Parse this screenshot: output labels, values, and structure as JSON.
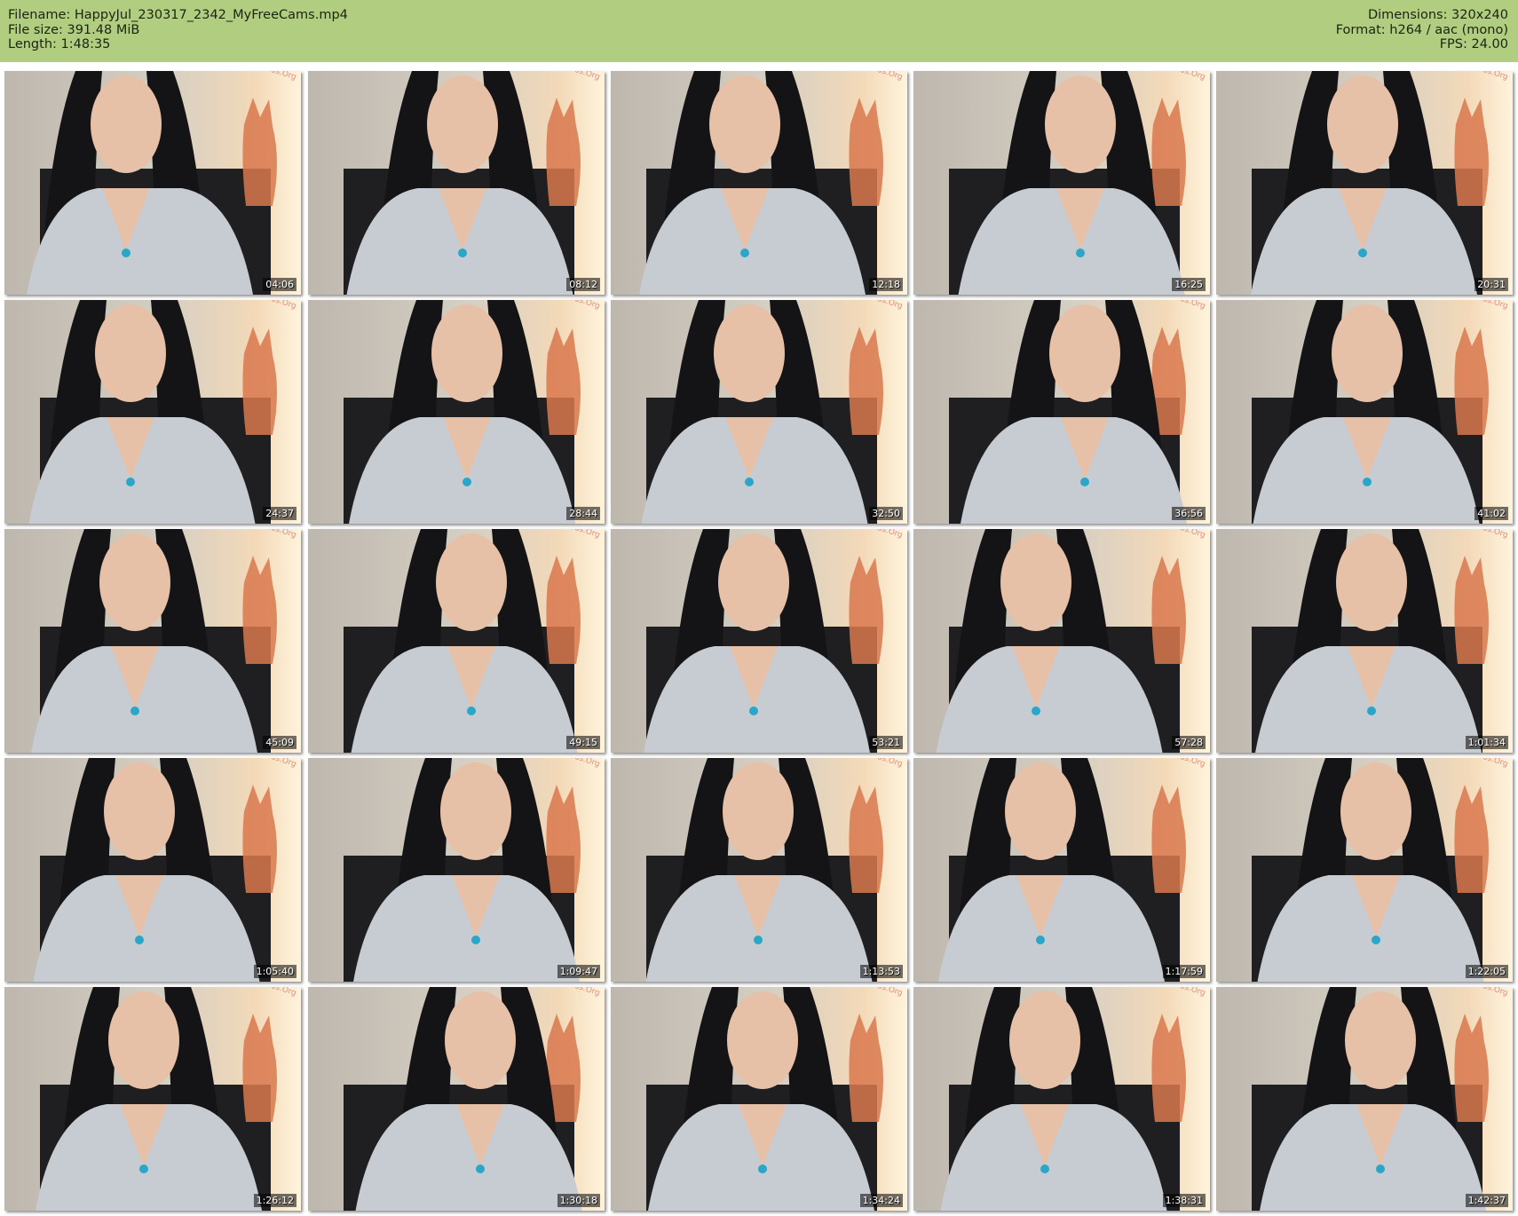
{
  "header": {
    "filename": "Filename: HappyJul_230317_2342_MyFreeCams.mp4",
    "filesize": "File size: 391.48 MiB",
    "length": "Length: 1:48:35",
    "dimensions": "Dimensions: 320x240",
    "format": "Format: h264 / aac (mono)",
    "fps": "FPS: 24.00"
  },
  "watermark": "ǊL-CamGirlVideos.Org",
  "thumbnails": [
    {
      "time": "04:06"
    },
    {
      "time": "08:12"
    },
    {
      "time": "12:18"
    },
    {
      "time": "16:25"
    },
    {
      "time": "20:31"
    },
    {
      "time": "24:37"
    },
    {
      "time": "28:44"
    },
    {
      "time": "32:50"
    },
    {
      "time": "36:56"
    },
    {
      "time": "41:02"
    },
    {
      "time": "45:09"
    },
    {
      "time": "49:15"
    },
    {
      "time": "53:21"
    },
    {
      "time": "57:28"
    },
    {
      "time": "1:01:34"
    },
    {
      "time": "1:05:40"
    },
    {
      "time": "1:09:47"
    },
    {
      "time": "1:13:53"
    },
    {
      "time": "1:17:59"
    },
    {
      "time": "1:22:05"
    },
    {
      "time": "1:26:12"
    },
    {
      "time": "1:30:18"
    },
    {
      "time": "1:34:24"
    },
    {
      "time": "1:38:31"
    },
    {
      "time": "1:42:37"
    }
  ]
}
